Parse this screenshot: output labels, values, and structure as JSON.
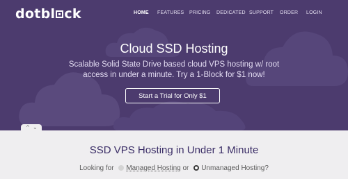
{
  "brand": {
    "logo_text_prefix": "dotbl",
    "logo_text_suffix": "ck"
  },
  "nav": {
    "items": [
      "HOME",
      "FEATURES",
      "PRICING",
      "DEDICATED",
      "SUPPORT",
      "ORDER",
      "LOGIN"
    ],
    "active": "HOME"
  },
  "hero": {
    "title": "Cloud SSD Hosting",
    "subtitle": "Scalable Solid State Drive based cloud VPS hosting w/ root access in under a minute. Try a 1-Block for $1 now!",
    "cta_label": "Start a Trial for Only $1"
  },
  "slider": {
    "prev_icon": "chevron-up-icon",
    "next_icon": "chevron-down-icon",
    "prev_glyph": "^",
    "next_glyph": "⌄"
  },
  "section": {
    "title": "SSD VPS Hosting in Under 1 Minute",
    "looking_for": "Looking for",
    "option_managed": "Managed Hosting",
    "connector": "or",
    "option_unmanaged": "Unmanaged Hosting?",
    "selected": "Unmanaged Hosting?"
  },
  "colors": {
    "hero_bg": "#4c3b6e",
    "cloud": "#5a4a7d",
    "page_bg": "#efeef0",
    "title": "#3a2d66"
  }
}
